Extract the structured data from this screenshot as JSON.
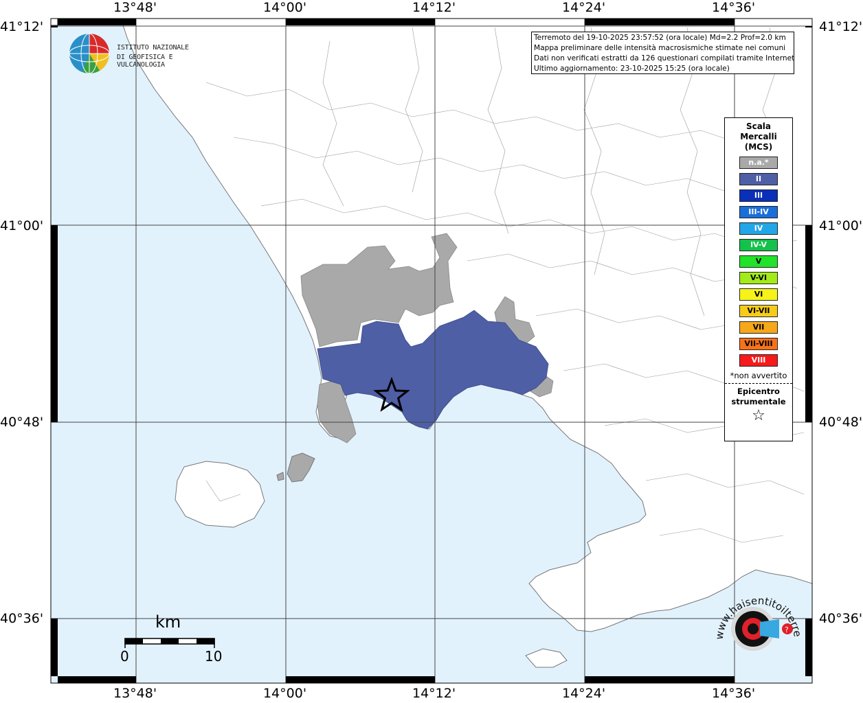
{
  "axes": {
    "top_lon": [
      "13°48'",
      "14°00'",
      "14°12'",
      "14°24'",
      "14°36'"
    ],
    "bottom_lon": [
      "13°48'",
      "14°00'",
      "14°12'",
      "14°24'",
      "14°36'"
    ],
    "left_lat": [
      "41°12'",
      "41°00'",
      "40°48'",
      "40°36'"
    ],
    "right_lat": [
      "41°12'",
      "41°00'",
      "40°48'",
      "40°36'"
    ]
  },
  "info_box": {
    "line1": "Terremoto del 19-10-2025 23:57:52 (ora locale) Md=2.2 Prof=2.0 km",
    "line2": "Mappa preliminare delle intensità macrosismiche stimate nei comuni",
    "line3": "Dati non verificati estratti da 126 questionari compilati tramite Internet.",
    "line4": "Ultimo aggiornamento: 23-10-2025 15:25 (ora locale)"
  },
  "logo": {
    "line1": "ISTITUTO NAZIONALE",
    "line2": "DI GEOFISICA E VULCANOLOGIA"
  },
  "legend": {
    "title1": "Scala",
    "title2": "Mercalli",
    "title3": "(MCS)",
    "items": [
      {
        "label": "n.a.*",
        "color": "#a9a9a9",
        "dark": false
      },
      {
        "label": "II",
        "color": "#4e5fa6",
        "dark": false
      },
      {
        "label": "III",
        "color": "#0a2fb8",
        "dark": false
      },
      {
        "label": "III-IV",
        "color": "#1a6ed8",
        "dark": false
      },
      {
        "label": "IV",
        "color": "#22a6e8",
        "dark": false
      },
      {
        "label": "IV-V",
        "color": "#12c24a",
        "dark": false
      },
      {
        "label": "V",
        "color": "#22e22a",
        "dark": true
      },
      {
        "label": "V-VI",
        "color": "#a2ea1a",
        "dark": true
      },
      {
        "label": "VI",
        "color": "#f6f21a",
        "dark": true
      },
      {
        "label": "VI-VII",
        "color": "#f6cc1a",
        "dark": true
      },
      {
        "label": "VII",
        "color": "#f6a81a",
        "dark": true
      },
      {
        "label": "VII-VIII",
        "color": "#f6721a",
        "dark": true
      },
      {
        "label": "VIII",
        "color": "#f61a1a",
        "dark": false
      }
    ],
    "na_note": "*non avvertito",
    "epi1": "Epicentro",
    "epi2": "strumentale",
    "star": "☆"
  },
  "scale": {
    "unit": "km",
    "min": "0",
    "max": "10"
  },
  "hsl_logo": {
    "text": "www.haisentitoilterremoto.it"
  },
  "colors": {
    "sea": "#e2f2fd",
    "land": "#ffffff",
    "intensity_II": "#4e5fa6",
    "na": "#a9a9a9"
  }
}
